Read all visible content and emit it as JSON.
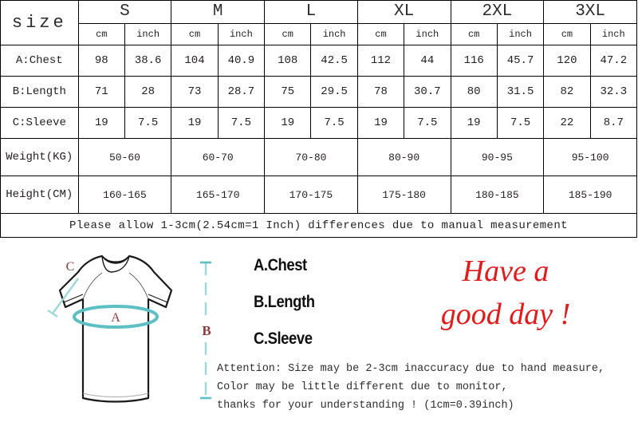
{
  "table": {
    "corner_label": "size",
    "sizes": [
      "S",
      "M",
      "L",
      "XL",
      "2XL",
      "3XL"
    ],
    "units": [
      "cm",
      "inch"
    ],
    "measurement_rows": [
      {
        "label": "A:Chest",
        "values": [
          "98",
          "38.6",
          "104",
          "40.9",
          "108",
          "42.5",
          "112",
          "44",
          "116",
          "45.7",
          "120",
          "47.2"
        ]
      },
      {
        "label": "B:Length",
        "values": [
          "71",
          "28",
          "73",
          "28.7",
          "75",
          "29.5",
          "78",
          "30.7",
          "80",
          "31.5",
          "82",
          "32.3"
        ]
      },
      {
        "label": "C:Sleeve",
        "values": [
          "19",
          "7.5",
          "19",
          "7.5",
          "19",
          "7.5",
          "19",
          "7.5",
          "19",
          "7.5",
          "22",
          "8.7"
        ]
      }
    ],
    "weight_row": {
      "label": "Weight(KG)",
      "values": [
        "50-60",
        "60-70",
        "70-80",
        "80-90",
        "90-95",
        "95-100"
      ]
    },
    "height_row": {
      "label": "Height(CM)",
      "values": [
        "160-165",
        "165-170",
        "170-175",
        "175-180",
        "180-185",
        "185-190"
      ]
    },
    "footer_note": "Please  allow 1-3cm(2.54cm=1 Inch)  differences due to manual measurement",
    "colors": {
      "cm_cell": "#fff200",
      "inch_cell": "#29abe2",
      "border": "#000000"
    }
  },
  "diagram": {
    "marker_chest": "A",
    "marker_sleeve": "C",
    "marker_length": "B",
    "marker_color": "#8b3a3a",
    "guide_color": "#5bbfc4",
    "outline_color": "#1a1a1a"
  },
  "legend": {
    "items": [
      "A.Chest",
      "B.Length",
      "C.Sleeve"
    ]
  },
  "greeting": {
    "line1": "Have a",
    "line2": "good day !",
    "color": "#e01b1b"
  },
  "attention": {
    "line1": "Attention: Size may be 2-3cm inaccuracy due to hand measure,",
    "line2": "Color may be little different due to monitor,",
    "line3": "thanks for your understanding ! (1cm=0.39inch)"
  }
}
